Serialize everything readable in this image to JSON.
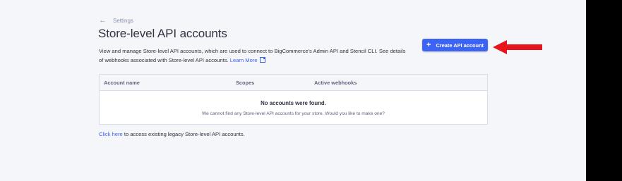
{
  "breadcrumb": {
    "back_label": "Settings"
  },
  "page": {
    "title": "Store-level API accounts",
    "description": "View and manage Store-level API accounts, which are used to connect to BigCommerce's Admin API and Stencil CLI. See details of webhooks associated with Store-level API accounts.",
    "learn_more": "Learn More"
  },
  "actions": {
    "create_label": "Create API account"
  },
  "table": {
    "columns": [
      "Account name",
      "Scopes",
      "Active webhooks"
    ],
    "empty_title": "No accounts were found.",
    "empty_message": "We cannot find any Store-level API accounts for your store. Would you like to make one?"
  },
  "footer": {
    "link_text": "Click here",
    "rest_text": " to access existing legacy Store-level API accounts."
  },
  "colors": {
    "accent": "#3c64f4",
    "annotation_arrow": "#e8141c"
  }
}
